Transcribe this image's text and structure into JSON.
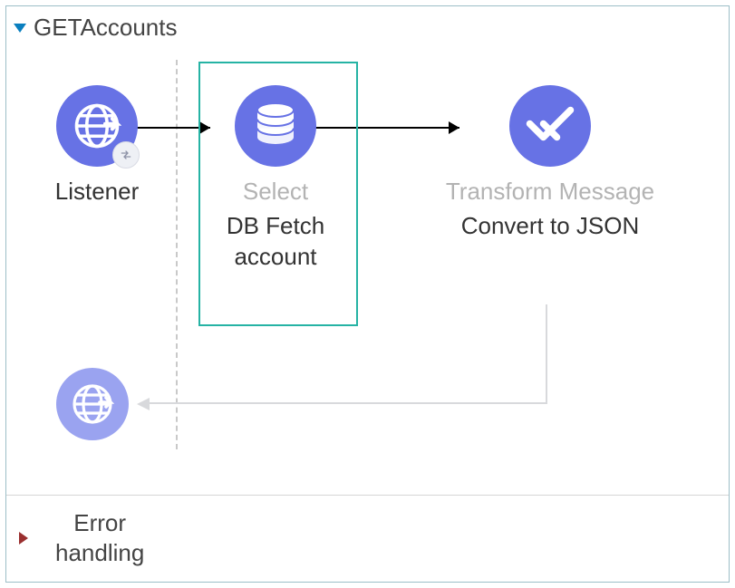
{
  "flow": {
    "title": "GETAccounts",
    "nodes": {
      "listener": {
        "type_label": "Listener",
        "name_label": ""
      },
      "dbfetch": {
        "type_label": "Select",
        "name_label": "DB Fetch account"
      },
      "transform": {
        "type_label": "Transform Message",
        "name_label": "Convert to JSON"
      }
    }
  },
  "error_section": {
    "label": "Error handling"
  }
}
